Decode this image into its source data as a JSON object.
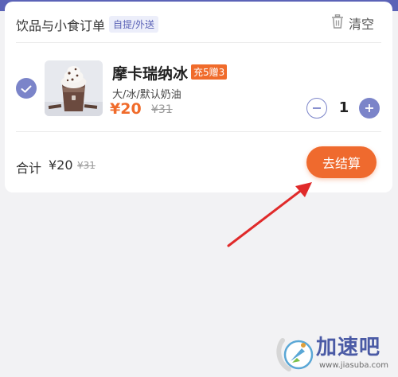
{
  "header": {
    "title": "饮品与小食订单",
    "tag": "自提/外送",
    "clear_label": "清空"
  },
  "item": {
    "name": "摩卡瑞纳冰",
    "promo": "充5赠3",
    "spec": "大/冰/默认奶油",
    "price": "¥20",
    "original_price": "¥31",
    "quantity": "1",
    "selected": true
  },
  "footer": {
    "total_label": "合计",
    "total_amount": "¥20",
    "total_original": "¥31",
    "checkout_label": "去结算"
  },
  "watermark": {
    "brand": "加速吧",
    "url": "www.jiasuba.com"
  },
  "colors": {
    "accent": "#7b84c9",
    "orange": "#ef6a2e",
    "arrow": "#e02a2a"
  },
  "icons": [
    "trash-icon",
    "check-icon",
    "minus-icon",
    "plus-icon",
    "arrow-annotation"
  ]
}
